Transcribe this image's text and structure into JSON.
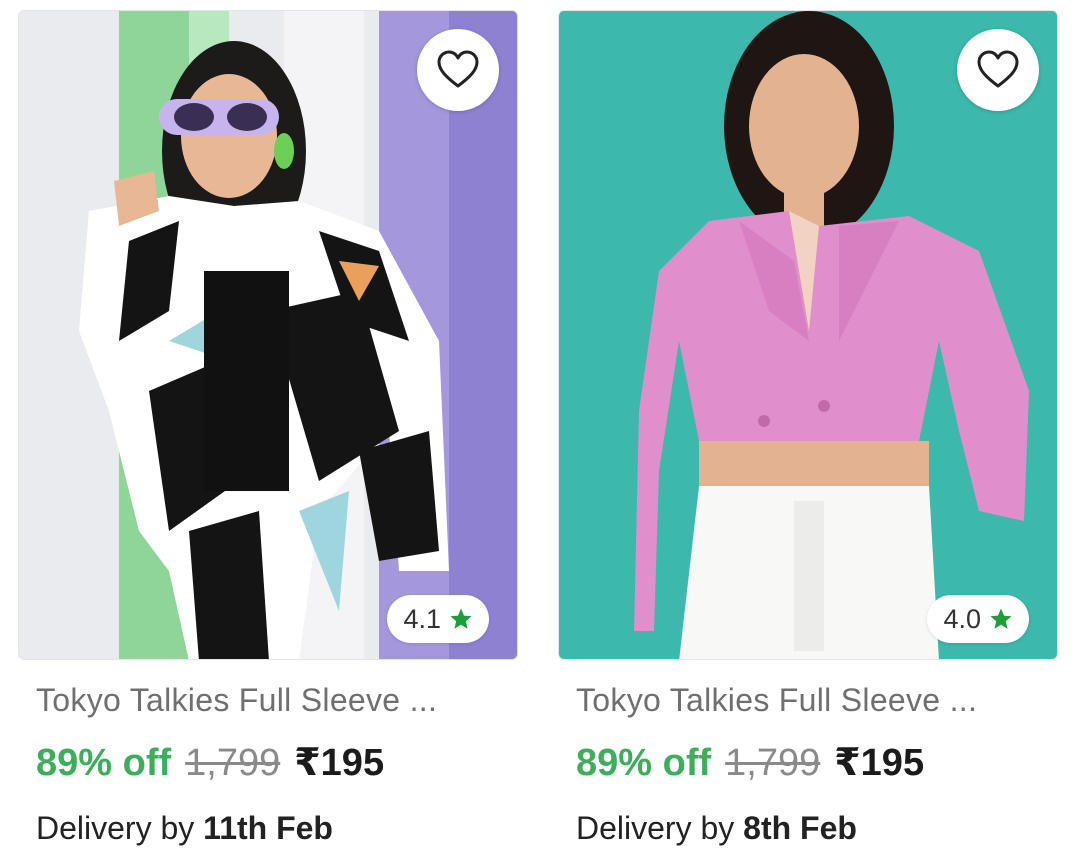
{
  "products": [
    {
      "title": "Tokyo Talkies Full Sleeve ...",
      "rating": "4.1",
      "discount": "89% off",
      "mrp": "1,799",
      "price": "₹195",
      "delivery_prefix": "Delivery by ",
      "delivery_date": "11th Feb"
    },
    {
      "title": "Tokyo Talkies Full Sleeve ...",
      "rating": "4.0",
      "discount": "89% off",
      "mrp": "1,799",
      "price": "₹195",
      "delivery_prefix": "Delivery by ",
      "delivery_date": "8th Feb"
    }
  ],
  "icons": {
    "wishlist": "heart-outline-icon",
    "rating": "star-icon"
  },
  "colors": {
    "discount": "#3cae5c",
    "star": "#1f9d3a",
    "card1_background": "#d9dbe8",
    "card2_background": "#3cb8ac"
  }
}
